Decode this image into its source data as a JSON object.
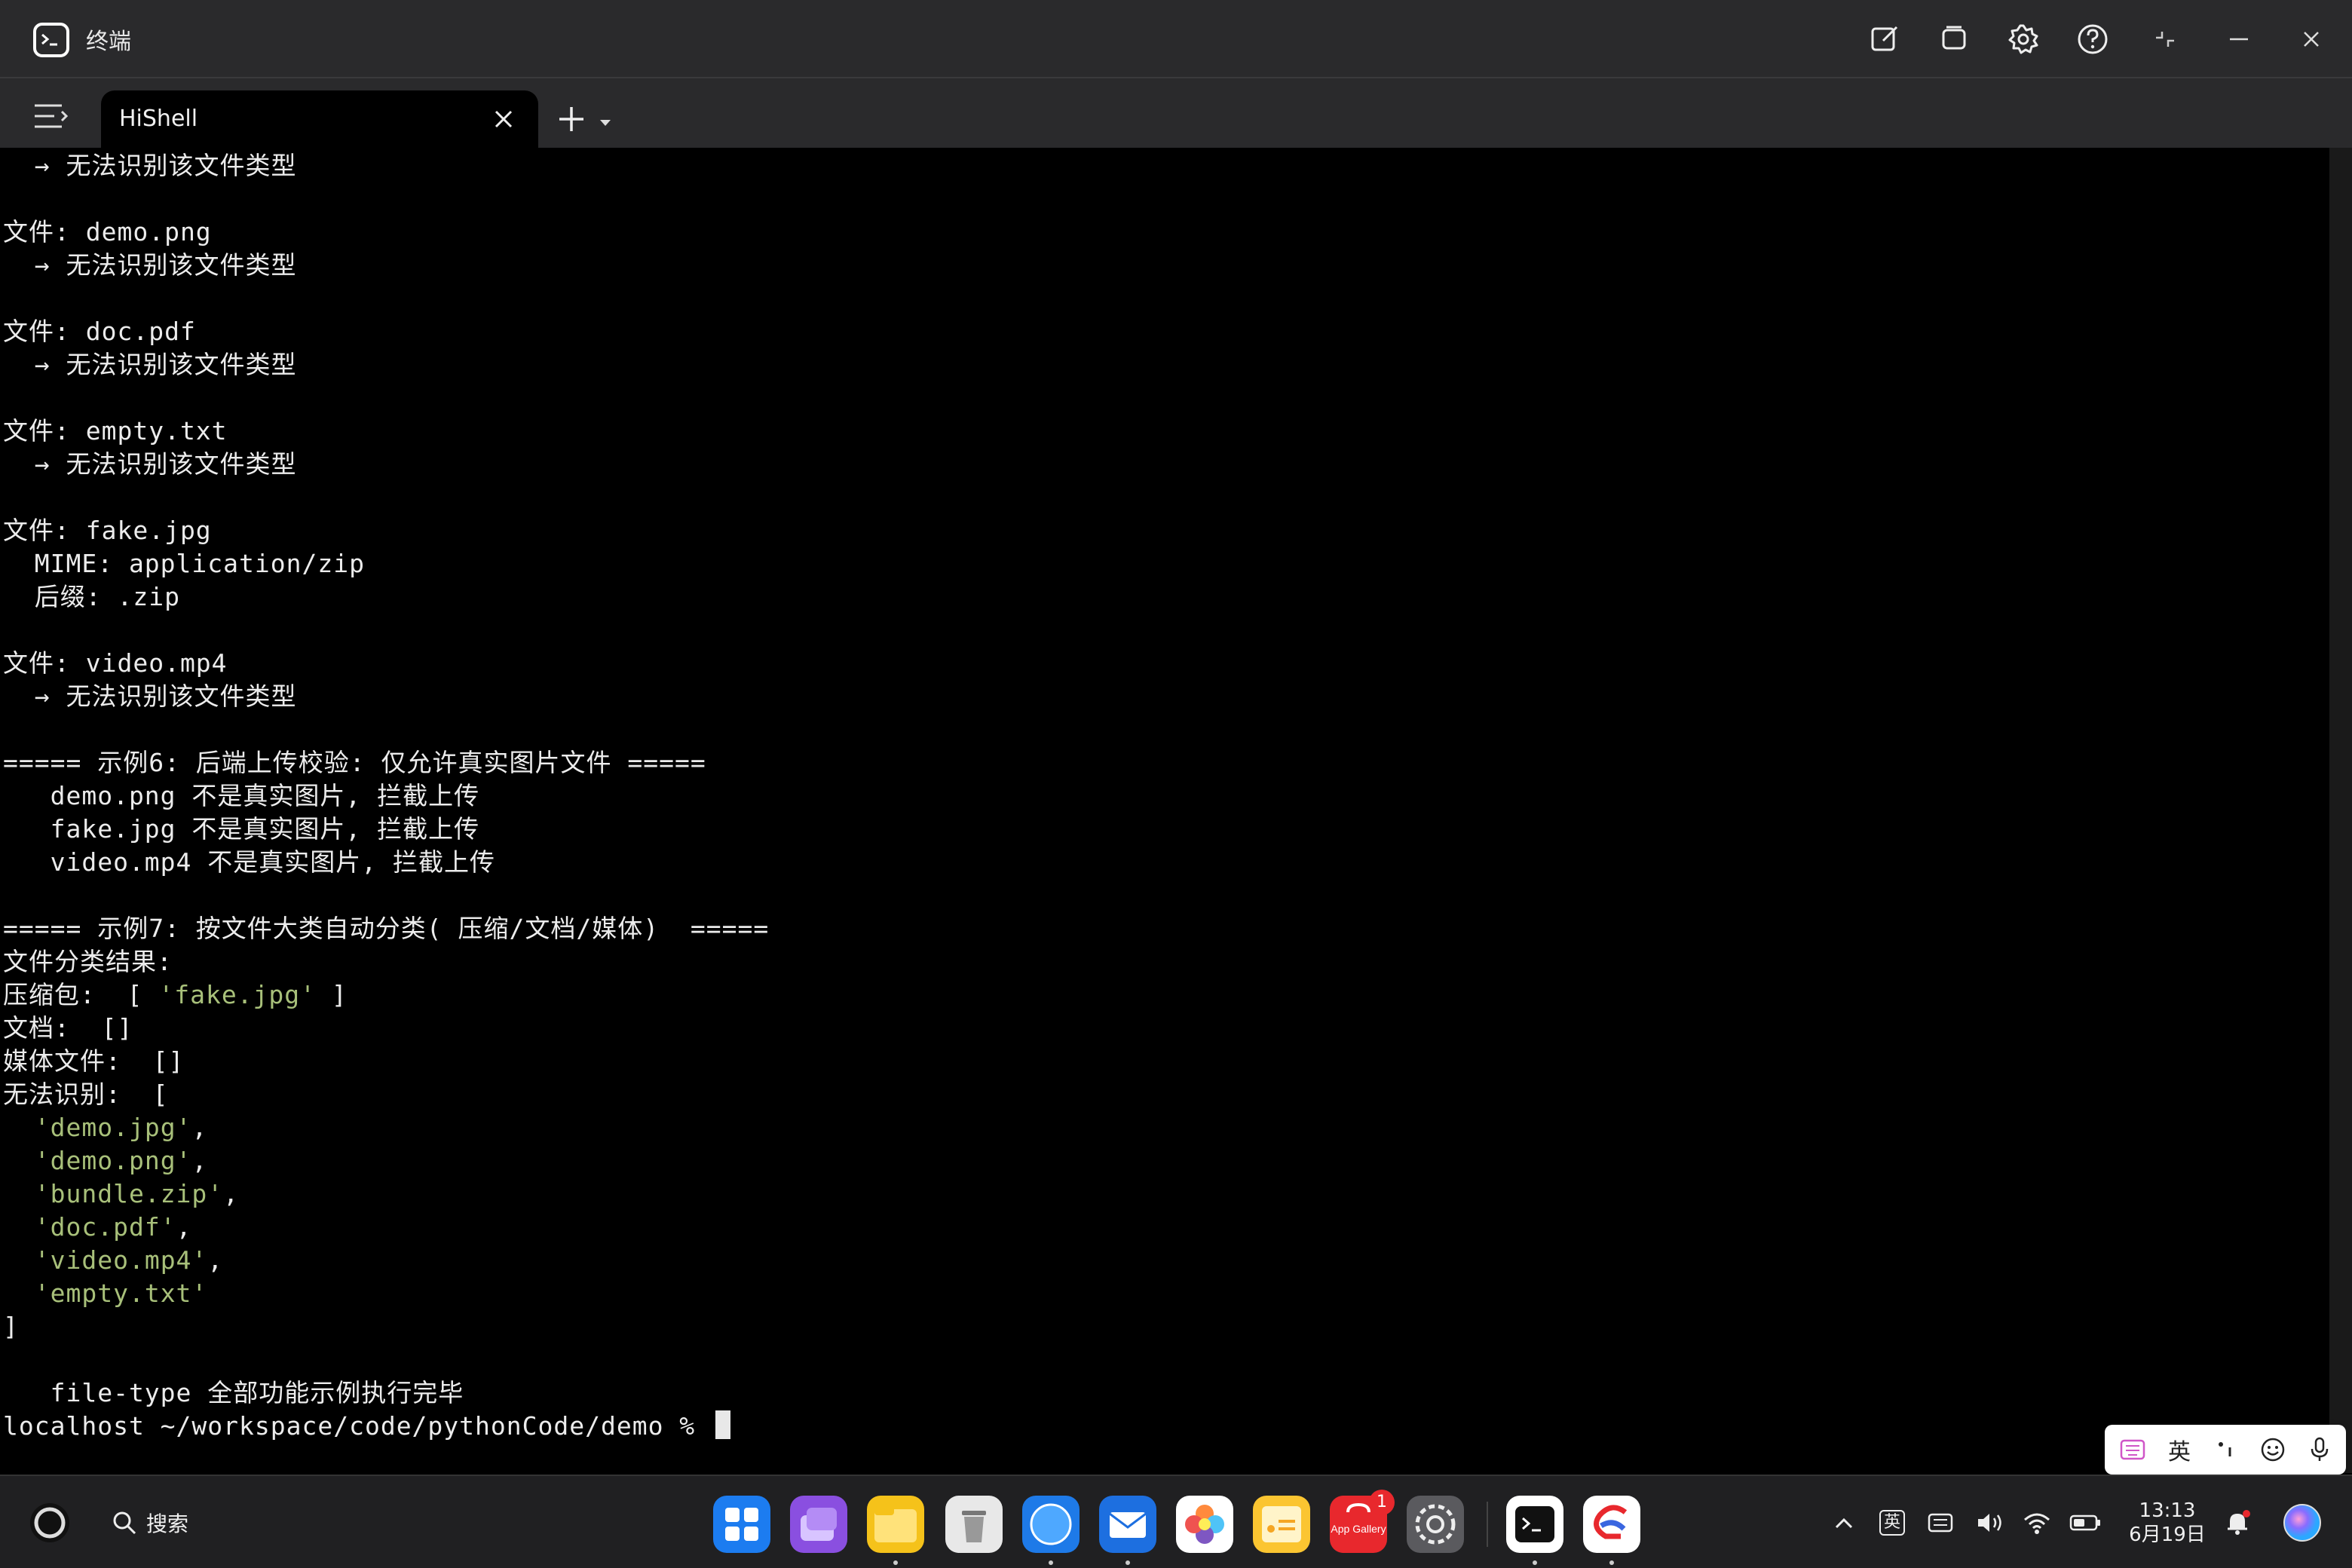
{
  "window": {
    "title": "终端"
  },
  "tabs": [
    {
      "label": "HiShell"
    }
  ],
  "terminal": {
    "lines": [
      [
        {
          "t": "  → 无法识别该文件类型"
        }
      ],
      [],
      [
        {
          "t": "文件: demo.png"
        }
      ],
      [
        {
          "t": "  → 无法识别该文件类型"
        }
      ],
      [],
      [
        {
          "t": "文件: doc.pdf"
        }
      ],
      [
        {
          "t": "  → 无法识别该文件类型"
        }
      ],
      [],
      [
        {
          "t": "文件: empty.txt"
        }
      ],
      [
        {
          "t": "  → 无法识别该文件类型"
        }
      ],
      [],
      [
        {
          "t": "文件: fake.jpg"
        }
      ],
      [
        {
          "t": "  MIME: application/zip"
        }
      ],
      [
        {
          "t": "  后缀: .zip"
        }
      ],
      [],
      [
        {
          "t": "文件: video.mp4"
        }
      ],
      [
        {
          "t": "  → 无法识别该文件类型"
        }
      ],
      [],
      [
        {
          "t": "===== 示例6: 后端上传校验: 仅允许真实图片文件 ====="
        }
      ],
      [
        {
          "t": "   demo.png 不是真实图片, 拦截上传"
        }
      ],
      [
        {
          "t": "   fake.jpg 不是真实图片, 拦截上传"
        }
      ],
      [
        {
          "t": "   video.mp4 不是真实图片, 拦截上传"
        }
      ],
      [],
      [
        {
          "t": "===== 示例7: 按文件大类自动分类( 压缩/文档/媒体)  ====="
        }
      ],
      [
        {
          "t": "文件分类结果:"
        }
      ],
      [
        {
          "t": "压缩包:  [ "
        },
        {
          "t": "'fake.jpg'",
          "c": "str"
        },
        {
          "t": " ]"
        }
      ],
      [
        {
          "t": "文档:  []"
        }
      ],
      [
        {
          "t": "媒体文件:  []"
        }
      ],
      [
        {
          "t": "无法识别:  ["
        }
      ],
      [
        {
          "t": "  "
        },
        {
          "t": "'demo.jpg'",
          "c": "str"
        },
        {
          "t": ","
        }
      ],
      [
        {
          "t": "  "
        },
        {
          "t": "'demo.png'",
          "c": "str"
        },
        {
          "t": ","
        }
      ],
      [
        {
          "t": "  "
        },
        {
          "t": "'bundle.zip'",
          "c": "str"
        },
        {
          "t": ","
        }
      ],
      [
        {
          "t": "  "
        },
        {
          "t": "'doc.pdf'",
          "c": "str"
        },
        {
          "t": ","
        }
      ],
      [
        {
          "t": "  "
        },
        {
          "t": "'video.mp4'",
          "c": "str"
        },
        {
          "t": ","
        }
      ],
      [
        {
          "t": "  "
        },
        {
          "t": "'empty.txt'",
          "c": "str"
        }
      ],
      [
        {
          "t": "]"
        }
      ],
      [],
      [
        {
          "t": "   file-type 全部功能示例执行完毕"
        }
      ]
    ],
    "prompt": "localhost ~/workspace/code/pythonCode/demo % "
  },
  "ime": {
    "lang": "英"
  },
  "taskbar": {
    "search_label": "搜索",
    "app_gallery_badge": "1",
    "app_gallery_label": "App Gallery",
    "tray_lang": "英",
    "time": "13:13",
    "date": "6月19日"
  },
  "colors": {
    "accent_string": "#a8c07a",
    "badge": "#e8282d"
  }
}
